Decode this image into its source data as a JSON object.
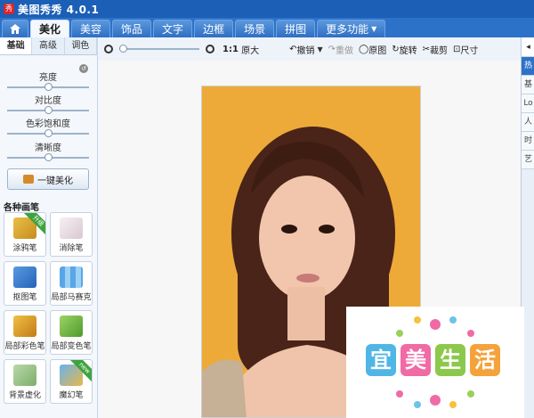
{
  "app": {
    "logo_text": "秀",
    "title": "美图秀秀 4.0.1"
  },
  "main_tabs": [
    {
      "label": "美化",
      "active": true
    },
    {
      "label": "美容"
    },
    {
      "label": "饰品"
    },
    {
      "label": "文字"
    },
    {
      "label": "边框"
    },
    {
      "label": "场景"
    },
    {
      "label": "拼图"
    },
    {
      "label": "更多功能"
    }
  ],
  "left_panel": {
    "subtabs": [
      "基础",
      "高级",
      "调色"
    ],
    "sliders": [
      {
        "label": "亮度",
        "value": 0.5
      },
      {
        "label": "对比度",
        "value": 0.5
      },
      {
        "label": "色彩饱和度",
        "value": 0.5
      },
      {
        "label": "清晰度",
        "value": 0.5
      }
    ],
    "oneclick_label": "一键美化",
    "brush_title": "各种画笔",
    "brushes": [
      {
        "label": "涂鸦笔",
        "badge": "升级"
      },
      {
        "label": "消除笔"
      },
      {
        "label": "抠图笔"
      },
      {
        "label": "局部马赛克"
      },
      {
        "label": "局部彩色笔"
      },
      {
        "label": "局部变色笔"
      },
      {
        "label": "背景虚化"
      },
      {
        "label": "魔幻笔",
        "badge": "new"
      }
    ]
  },
  "toolbar": {
    "ratio_label": "1:1",
    "original_size": "原大",
    "undo": "撤销",
    "redo": "重做",
    "original": "原图",
    "rotate": "旋转",
    "crop": "裁剪",
    "size": "尺寸"
  },
  "right_panel": {
    "items": [
      "热",
      "基",
      "Lo",
      "人",
      "时",
      "艺"
    ]
  },
  "watermark": {
    "chars": [
      "宜",
      "美",
      "生",
      "活"
    ]
  },
  "colors": {
    "title_bar": "#1b5fb6",
    "tab_bar": "#2d72c9",
    "accent": "#2d72c9"
  }
}
